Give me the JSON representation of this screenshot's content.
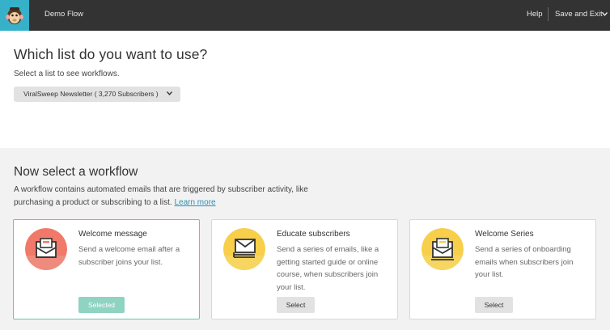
{
  "header": {
    "app_title": "Demo Flow",
    "help": "Help",
    "save_exit": "Save and Exit"
  },
  "list_section": {
    "title": "Which list do you want to use?",
    "subtitle": "Select a list to see workflows.",
    "selected_list": "ViralSweep Newsletter ( 3,270 Subscribers )"
  },
  "workflow_section": {
    "title": "Now select a workflow",
    "description": "A workflow contains automated emails that are triggered by subscriber activity, like purchasing a product or subscribing to a list.",
    "learn_more": "Learn more"
  },
  "cards": [
    {
      "title": "Welcome message",
      "body": "Send a welcome email after a subscriber joins your list.",
      "button": "Selected",
      "selected": true,
      "icon": "envelope-icon",
      "icon_color": "#f0796a"
    },
    {
      "title": "Educate subscribers",
      "body": "Send a series of emails, like a getting started guide or online course, when subscribers join your list.",
      "button": "Select",
      "selected": false,
      "icon": "envelopes-stack-icon",
      "icon_color": "#f7cf4a"
    },
    {
      "title": "Welcome Series",
      "body": "Send a series of onboarding emails when subscribers join your list.",
      "button": "Select",
      "selected": false,
      "icon": "envelope-icon",
      "icon_color": "#f7cf4a"
    }
  ],
  "colors": {
    "topbar": "#333333",
    "logo_bg": "#36b1c9",
    "accent_teal": "#8fd3c2",
    "link": "#2b8fb7"
  }
}
